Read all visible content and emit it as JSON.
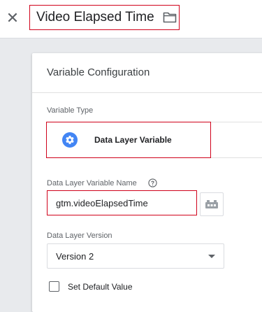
{
  "header": {
    "close_icon": "close-icon",
    "title": "Video Elapsed Time",
    "folder_icon": "folder-icon"
  },
  "card": {
    "title": "Variable Configuration",
    "variable_type": {
      "label": "Variable Type",
      "value": "Data Layer Variable",
      "icon": "gear-icon",
      "icon_color": "#4285f4"
    },
    "dlv_name": {
      "label": "Data Layer Variable Name",
      "help_icon": "help-icon",
      "value": "gtm.videoElapsedTime",
      "picker_icon": "variable-picker-icon"
    },
    "dl_version": {
      "label": "Data Layer Version",
      "selected": "Version 2"
    },
    "default_value": {
      "label": "Set Default Value",
      "checked": false
    }
  },
  "colors": {
    "highlight": "#d0021b",
    "accent": "#4285f4"
  }
}
